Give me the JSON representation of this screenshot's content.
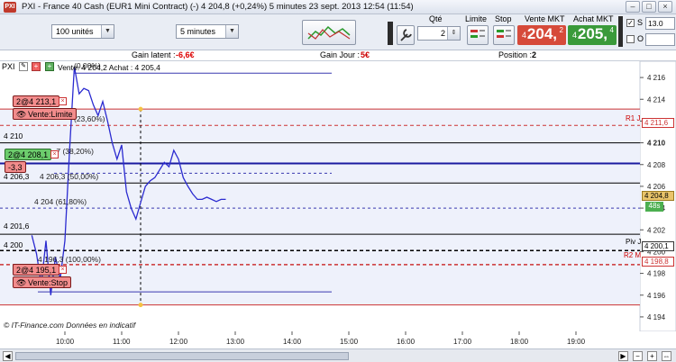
{
  "window": {
    "title": "PXI - France 40 Cash (EUR1 Mini Contract) (-)    4 204,8 (+0,24%)    5 minutes   23 sept. 2013 12:54 (11:54)",
    "app_badge": "PXI",
    "minimize": "–",
    "maximize": "□",
    "close": "×"
  },
  "toolbar": {
    "units_select": "100 unités",
    "period_select": "5 minutes",
    "qty_label": "Qté",
    "qty_value": "2",
    "limit_label": "Limite",
    "stop_label": "Stop",
    "sell_label": "Vente MKT",
    "buy_label": "Achat MKT",
    "sell_prefix": "4",
    "sell_big": "204,",
    "sell_sup": "2",
    "buy_prefix": "4",
    "buy_big": "205,",
    "buy_sup": "4",
    "s_label": "S",
    "o_label": "O",
    "s_value": "13.0",
    "o_value": "",
    "colors": {
      "sell": "#d64a3a",
      "buy": "#3a9a3a"
    }
  },
  "infobar": {
    "gain_latent_label": "Gain latent :",
    "gain_latent_value": "-6,6€",
    "gain_jour_label": "Gain Jour :",
    "gain_jour_value": "5€",
    "position_label": "Position :",
    "position_value": "2"
  },
  "chart": {
    "header": "Vente: 4 204,2 Achat : 4 205,4",
    "chart_toolbar_label": "PXI",
    "fib_labels": [
      "(0,00%)",
      "(23,60%)",
      ",7 (38,20%)",
      "4 206,3 (50,00%)",
      "4 204 (61,80%)",
      "4 196,3 (100,00%)"
    ],
    "left_levels": [
      "4 210",
      "4 206,3",
      "4 201,6",
      "4 200"
    ],
    "right_tags": {
      "r1": "R1 J",
      "r1_price": "4 211,6",
      "piv": "Piv J",
      "piv_price": "4 200,1",
      "r2": "R2 M",
      "r2_price": "4 198,8",
      "last_price": "4 204,8",
      "timer": "48s"
    },
    "y_ticks": [
      "4 216",
      "4 214",
      "4 212",
      "4 210",
      "4 208",
      "4 206",
      "4 204",
      "4 202",
      "4 200",
      "4 198",
      "4 196",
      "4 194"
    ],
    "x_ticks": [
      "10:00",
      "11:00",
      "12:00",
      "13:00",
      "14:00",
      "15:00",
      "16:00",
      "17:00",
      "18:00",
      "19:00"
    ],
    "footer": "© IT-Finance.com  Données en indicatif",
    "orders": {
      "limit_sell": "2@4 213,1",
      "limit_sell_type": "Vente:Limite",
      "position": "2@4 208,1",
      "position_pl": "-3,3",
      "stop_sell": "2@4 195,1",
      "stop_sell_type": "Vente:Stop"
    }
  },
  "chart_data": {
    "type": "line",
    "title": "PXI - France 40 Cash (EUR1 Mini Contract)",
    "x": [
      "09:25",
      "09:30",
      "09:35",
      "09:40",
      "09:45",
      "09:50",
      "09:55",
      "10:00",
      "10:05",
      "10:10",
      "10:15",
      "10:20",
      "10:25",
      "10:30",
      "10:35",
      "10:40",
      "10:45",
      "10:50",
      "10:55",
      "11:00",
      "11:05",
      "11:10",
      "11:15",
      "11:20",
      "11:25",
      "11:30",
      "11:35",
      "11:40",
      "11:45",
      "11:50",
      "11:55",
      "12:00",
      "12:05",
      "12:10",
      "12:15",
      "12:20",
      "12:25",
      "12:30",
      "12:35",
      "12:40",
      "12:45",
      "12:50"
    ],
    "series": [
      {
        "name": "PXI",
        "values": [
          4201.5,
          4199.8,
          4197.0,
          4201.0,
          4196.0,
          4199.5,
          4197.5,
          4201.0,
          4209.5,
          4217.0,
          4214.5,
          4215.0,
          4214.8,
          4213.5,
          4212.5,
          4213.8,
          4212.0,
          4210.0,
          4208.5,
          4209.8,
          4205.5,
          4204.0,
          4203.0,
          4204.5,
          4206.0,
          4206.5,
          4206.8,
          4207.5,
          4208.2,
          4207.8,
          4209.3,
          4208.5,
          4206.8,
          4206.0,
          4205.3,
          4204.8,
          4204.8,
          4205.0,
          4204.8,
          4204.6,
          4204.8,
          4204.8
        ]
      }
    ],
    "ylim": [
      4193,
      4217
    ],
    "hlines": [
      4213.1,
      4211.6,
      4210.0,
      4208.1,
      4206.3,
      4204.0,
      4201.6,
      4200.1,
      4198.8,
      4195.1
    ]
  }
}
